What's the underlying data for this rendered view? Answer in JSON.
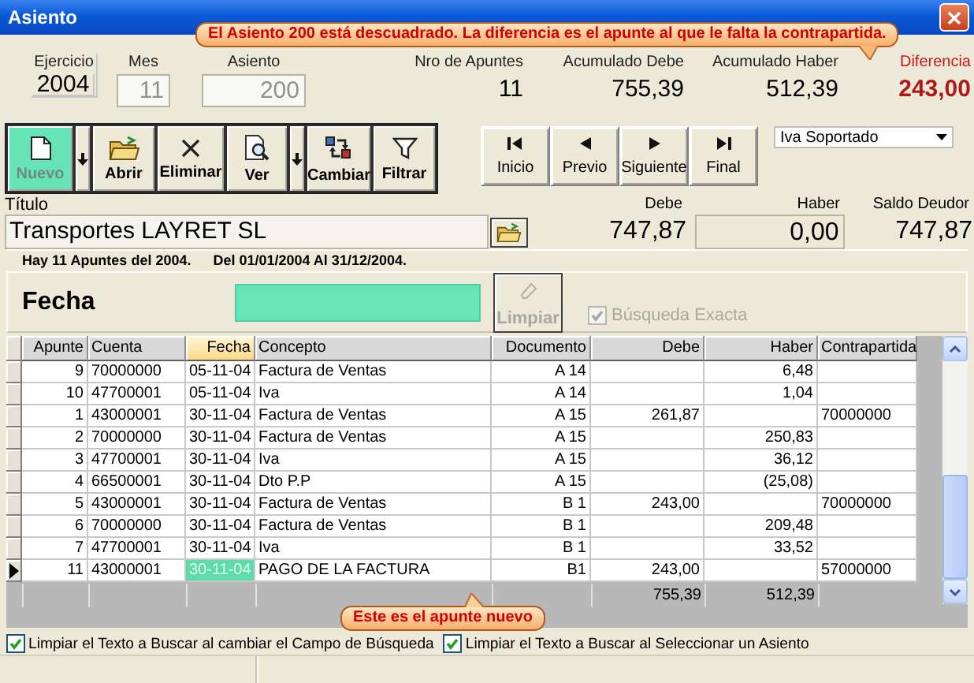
{
  "window": {
    "title": "Asiento"
  },
  "alert_callout": {
    "text": "El Asiento 200 está descuadrado. La diferencia es el apunte al que le falta la contrapartida."
  },
  "header": [
    {
      "label": "Ejercicio",
      "value": "2004",
      "kind": "text"
    },
    {
      "label": "Mes",
      "value": "11",
      "kind": "field"
    },
    {
      "label": "Asiento",
      "value": "200",
      "kind": "field"
    },
    {
      "label": "Nro de Apuntes",
      "value": "11",
      "kind": "number"
    },
    {
      "label": "Acumulado Debe",
      "value": "755,39",
      "kind": "number"
    },
    {
      "label": "Acumulado Haber",
      "value": "512,39",
      "kind": "number"
    },
    {
      "label": "Diferencia",
      "value": "243,00",
      "kind": "alert"
    }
  ],
  "toolbar": [
    {
      "label": "Nuevo",
      "selected": true,
      "dropdown": true
    },
    {
      "label": "Abrir",
      "selected": false,
      "dropdown": false
    },
    {
      "label": "Eliminar",
      "selected": false,
      "dropdown": false
    },
    {
      "label": "Ver",
      "selected": false,
      "dropdown": true
    },
    {
      "label": "Cambiar",
      "selected": false,
      "dropdown": false
    },
    {
      "label": "Filtrar",
      "selected": false,
      "dropdown": false
    }
  ],
  "navigation": [
    {
      "label": "Inicio"
    },
    {
      "label": "Previo"
    },
    {
      "label": "Siguiente"
    },
    {
      "label": "Final"
    }
  ],
  "account_dropdown": {
    "value": "Iva Soportado"
  },
  "title_row": {
    "label": "Título",
    "value": "Transportes LAYRET SL"
  },
  "balances": [
    {
      "label": "Debe",
      "value": "747,87",
      "kind": "flat"
    },
    {
      "label": "Haber",
      "value": "0,00",
      "kind": "field"
    },
    {
      "label": "Saldo Deudor",
      "value": "747,87",
      "kind": "flat"
    }
  ],
  "info_bar": {
    "count": "Hay 11 Apuntes del 2004.",
    "range": "Del 01/01/2004 Al 31/12/2004."
  },
  "search": {
    "field_label": "Fecha",
    "clear_button": {
      "label": "Limpiar",
      "disabled": true
    },
    "exact_match": {
      "label": "Búsqueda Exacta",
      "checked": true,
      "disabled": true
    }
  },
  "table": {
    "columns": [
      {
        "label": "Apunte",
        "sorted": false
      },
      {
        "label": "Cuenta",
        "sorted": false
      },
      {
        "label": "Fecha",
        "sorted": true
      },
      {
        "label": "Concepto",
        "sorted": false
      },
      {
        "label": "Documento",
        "sorted": false
      },
      {
        "label": "Debe",
        "sorted": false
      },
      {
        "label": "Haber",
        "sorted": false
      },
      {
        "label": "Contrapartida",
        "sorted": false
      }
    ],
    "rows": [
      {
        "apunte": "9",
        "cuenta": "70000000",
        "fecha": "05-11-04",
        "concepto": "Factura de Ventas",
        "documento": "A 14",
        "haber": "6,48",
        "current": false
      },
      {
        "apunte": "10",
        "cuenta": "47700001",
        "fecha": "05-11-04",
        "concepto": "Iva",
        "documento": "A 14",
        "haber": "1,04",
        "current": false
      },
      {
        "apunte": "1",
        "cuenta": "43000001",
        "fecha": "30-11-04",
        "concepto": "Factura de Ventas",
        "documento": "A 15",
        "debe": "261,87",
        "contrapartida": "70000000",
        "current": false
      },
      {
        "apunte": "2",
        "cuenta": "70000000",
        "fecha": "30-11-04",
        "concepto": "Factura de Ventas",
        "documento": "A 15",
        "haber": "250,83",
        "current": false
      },
      {
        "apunte": "3",
        "cuenta": "47700001",
        "fecha": "30-11-04",
        "concepto": "Iva",
        "documento": "A 15",
        "haber": "36,12",
        "current": false
      },
      {
        "apunte": "4",
        "cuenta": "66500001",
        "fecha": "30-11-04",
        "concepto": "Dto P.P",
        "documento": "A 15",
        "haber": "(25,08)",
        "current": false
      },
      {
        "apunte": "5",
        "cuenta": "43000001",
        "fecha": "30-11-04",
        "concepto": "Factura de Ventas",
        "documento": "B 1",
        "debe": "243,00",
        "contrapartida": "70000000",
        "current": false
      },
      {
        "apunte": "6",
        "cuenta": "70000000",
        "fecha": "30-11-04",
        "concepto": "Factura de Ventas",
        "documento": "B 1",
        "haber": "209,48",
        "current": false
      },
      {
        "apunte": "7",
        "cuenta": "47700001",
        "fecha": "30-11-04",
        "concepto": "Iva",
        "documento": "B 1",
        "haber": "33,52",
        "current": false
      },
      {
        "apunte": "11",
        "cuenta": "43000001",
        "fecha": "30-11-04",
        "concepto": "PAGO DE LA FACTURA",
        "documento": "B1",
        "debe": "243,00",
        "contrapartida": "57000000",
        "current": true
      }
    ],
    "totals": {
      "debe": "755,39",
      "haber": "512,39"
    }
  },
  "row_callout": {
    "text": "Este es el apunte nuevo"
  },
  "options": [
    {
      "label": "Limpiar el Texto a Buscar al cambiar el Campo de Búsqueda",
      "checked": true
    },
    {
      "label": "Limpiar el Texto a Buscar al Seleccionar un Asiento",
      "checked": true
    }
  ]
}
